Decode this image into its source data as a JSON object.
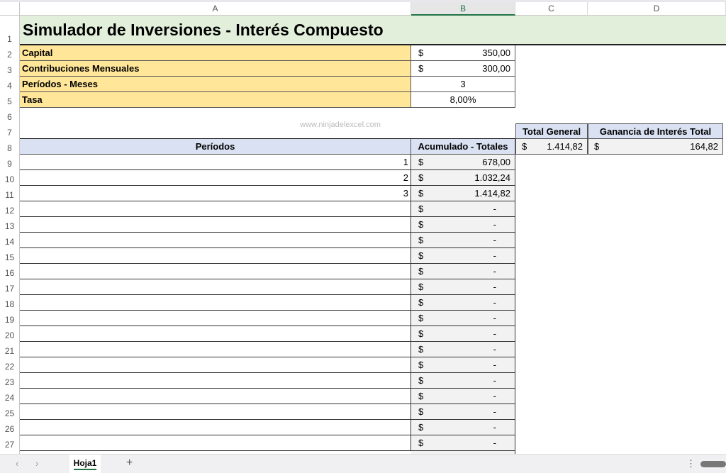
{
  "columns": [
    "A",
    "B",
    "C",
    "D"
  ],
  "title": "Simulador de Inversiones - Interés Compuesto",
  "inputs": [
    {
      "label": "Capital",
      "currency": "$",
      "value": "350,00"
    },
    {
      "label": "Contribuciones Mensuales",
      "currency": "$",
      "value": "300,00"
    },
    {
      "label": "Períodos - Meses",
      "currency": "",
      "value": "3"
    },
    {
      "label": "Tasa",
      "currency": "",
      "value": "8,00%"
    }
  ],
  "watermark": "www.ninjadelexcel.com",
  "summary": {
    "total_label": "Total General",
    "interest_label": "Ganancia de Interés Total",
    "currency": "$",
    "total": "1.414,82",
    "interest": "164,82"
  },
  "table": {
    "col1": "Períodos",
    "col2": "Acumulado - Totales",
    "rows": [
      {
        "n": 9,
        "period": "1",
        "value": "678,00"
      },
      {
        "n": 10,
        "period": "2",
        "value": "1.032,24"
      },
      {
        "n": 11,
        "period": "3",
        "value": "1.414,82"
      },
      {
        "n": 12,
        "period": "",
        "value": "-"
      },
      {
        "n": 13,
        "period": "",
        "value": "-"
      },
      {
        "n": 14,
        "period": "",
        "value": "-"
      },
      {
        "n": 15,
        "period": "",
        "value": "-"
      },
      {
        "n": 16,
        "period": "",
        "value": "-"
      },
      {
        "n": 17,
        "period": "",
        "value": "-"
      },
      {
        "n": 18,
        "period": "",
        "value": "-"
      },
      {
        "n": 19,
        "period": "",
        "value": "-"
      },
      {
        "n": 20,
        "period": "",
        "value": "-"
      },
      {
        "n": 21,
        "period": "",
        "value": "-"
      },
      {
        "n": 22,
        "period": "",
        "value": "-"
      },
      {
        "n": 23,
        "period": "",
        "value": "-"
      },
      {
        "n": 24,
        "period": "",
        "value": "-"
      },
      {
        "n": 25,
        "period": "",
        "value": "-"
      },
      {
        "n": 26,
        "period": "",
        "value": "-"
      },
      {
        "n": 27,
        "period": "",
        "value": "-"
      }
    ]
  },
  "sheet_tabs": [
    "Hoja1"
  ],
  "add_sheet": "+",
  "colors": {
    "title_bg": "#e2efda",
    "input_bg": "#ffe699",
    "header_bg": "#d9e1f2",
    "value_bg": "#f2f2f2",
    "accent": "#217346"
  }
}
